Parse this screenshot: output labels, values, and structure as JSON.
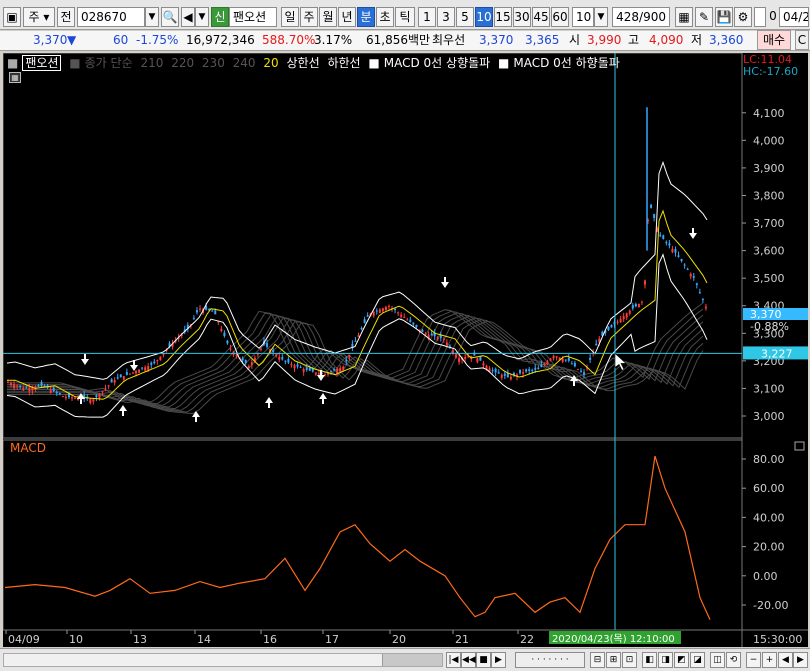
{
  "toolbar": {
    "market_label": "주",
    "prev_label": "전",
    "code": "028670",
    "credit_badge": "신",
    "stock_name": "팬오션",
    "period_buttons": [
      "일",
      "주",
      "월",
      "년",
      "분",
      "초",
      "틱"
    ],
    "active_period": "분",
    "interval_buttons": [
      "1",
      "3",
      "5",
      "10",
      "15",
      "30",
      "45",
      "60"
    ],
    "active_interval": "10",
    "interval_select": "10",
    "count_display": "428/900",
    "date_display": "04/2",
    "checkbox_label": "0"
  },
  "quote": {
    "price": "3,370",
    "down_arrow": "▼",
    "change": "60",
    "change_pct": "-1.75%",
    "volume": "16,972,346",
    "volume_ratio": "588.70%",
    "turnover": "3.17%",
    "amount": "61,856백만",
    "priority_label": "최우선",
    "ask": "3,370",
    "bid": "3,365",
    "open_label": "시",
    "open": "3,990",
    "high_label": "고",
    "high": "4,090",
    "low_label": "저",
    "low": "3,360",
    "buy_button": "매수",
    "side_button": "C"
  },
  "legend": {
    "name": "팬오션",
    "ma_label": "종가 단순",
    "ma_periods": [
      "210",
      "220",
      "230",
      "240",
      "20"
    ],
    "upper_label": "상한선",
    "lower_label": "하한선",
    "macd_up": "MACD 0선 상향돌파",
    "macd_down": "MACD 0선 하향돌파",
    "lc": "LC:11.04",
    "hc": "HC:-17.60"
  },
  "price_axis": [
    "4,100",
    "4,000",
    "3,900",
    "3,800",
    "3,700",
    "3,600",
    "3,500",
    "3,400",
    "3,300",
    "3,200",
    "3,100",
    "3,000"
  ],
  "price_tags": {
    "current": "3,370",
    "current_pct": "-0.88%",
    "cursor": "3,227"
  },
  "macd_axis": [
    "80.00",
    "60.00",
    "40.00",
    "20.00",
    "0.00",
    "-20.00"
  ],
  "macd_label": "MACD",
  "date_axis": [
    "04/09",
    "10",
    "13",
    "14",
    "16",
    "17",
    "20",
    "21",
    "22"
  ],
  "cursor_date": "2020/04/23(목) 12:10:00",
  "end_time": "15:30:00",
  "colors": {
    "up": "#ff3b3b",
    "down": "#35a8ff",
    "ma20": "#f0e000",
    "band": "#ffffff",
    "macd": "#ff6a1a",
    "crosshair": "#2ec7e6"
  }
}
